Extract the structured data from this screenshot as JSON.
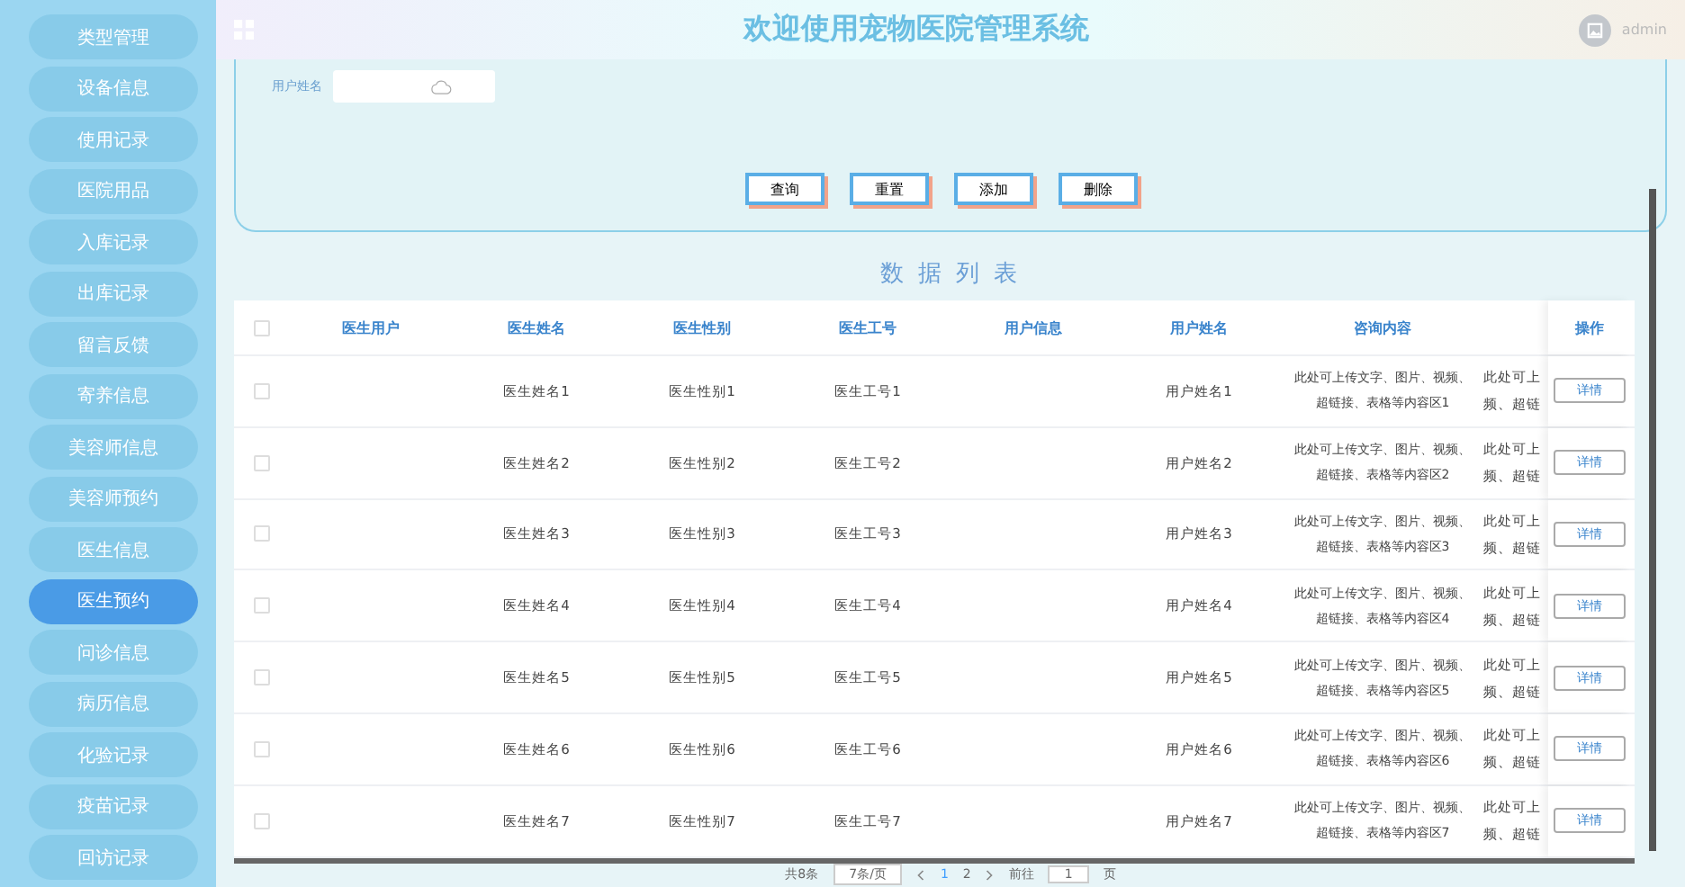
{
  "sidebar": {
    "items": [
      {
        "label": "类型管理",
        "selected": false
      },
      {
        "label": "设备信息",
        "selected": false
      },
      {
        "label": "使用记录",
        "selected": false
      },
      {
        "label": "医院用品",
        "selected": false
      },
      {
        "label": "入库记录",
        "selected": false
      },
      {
        "label": "出库记录",
        "selected": false
      },
      {
        "label": "留言反馈",
        "selected": false
      },
      {
        "label": "寄养信息",
        "selected": false
      },
      {
        "label": "美容师信息",
        "selected": false
      },
      {
        "label": "美容师预约",
        "selected": false
      },
      {
        "label": "医生信息",
        "selected": false
      },
      {
        "label": "医生预约",
        "selected": true
      },
      {
        "label": "问诊信息",
        "selected": false
      },
      {
        "label": "病历信息",
        "selected": false
      },
      {
        "label": "化验记录",
        "selected": false
      },
      {
        "label": "疫苗记录",
        "selected": false
      },
      {
        "label": "回访记录",
        "selected": false
      }
    ]
  },
  "header": {
    "title": "欢迎使用宠物医院管理系统",
    "user": "admin"
  },
  "search": {
    "label": "用户姓名",
    "buttons": [
      "查询",
      "重置",
      "添加",
      "删除"
    ]
  },
  "section_title": "数 据 列 表",
  "table": {
    "select_all_checked": false,
    "columns": [
      "医生用户",
      "医生姓名",
      "医生性别",
      "医生工号",
      "用户信息",
      "用户姓名",
      "咨询内容",
      "操作"
    ],
    "rows": [
      {
        "checked": false,
        "cells": [
          "",
          "医生姓名1",
          "医生性别1",
          "医生工号1",
          "",
          "用户姓名1",
          "此处可上传文字、图片、视频、超链接、表格等内容区1",
          "此处可上频、超链"
        ],
        "action": "详情"
      },
      {
        "checked": false,
        "cells": [
          "",
          "医生姓名2",
          "医生性别2",
          "医生工号2",
          "",
          "用户姓名2",
          "此处可上传文字、图片、视频、超链接、表格等内容区2",
          "此处可上频、超链"
        ],
        "action": "详情"
      },
      {
        "checked": false,
        "cells": [
          "",
          "医生姓名3",
          "医生性别3",
          "医生工号3",
          "",
          "用户姓名3",
          "此处可上传文字、图片、视频、超链接、表格等内容区3",
          "此处可上频、超链"
        ],
        "action": "详情"
      },
      {
        "checked": false,
        "cells": [
          "",
          "医生姓名4",
          "医生性别4",
          "医生工号4",
          "",
          "用户姓名4",
          "此处可上传文字、图片、视频、超链接、表格等内容区4",
          "此处可上频、超链"
        ],
        "action": "详情"
      },
      {
        "checked": false,
        "cells": [
          "",
          "医生姓名5",
          "医生性别5",
          "医生工号5",
          "",
          "用户姓名5",
          "此处可上传文字、图片、视频、超链接、表格等内容区5",
          "此处可上频、超链"
        ],
        "action": "详情"
      },
      {
        "checked": false,
        "cells": [
          "",
          "医生姓名6",
          "医生性别6",
          "医生工号6",
          "",
          "用户姓名6",
          "此处可上传文字、图片、视频、超链接、表格等内容区6",
          "此处可上频、超链"
        ],
        "action": "详情"
      },
      {
        "checked": false,
        "cells": [
          "",
          "医生姓名7",
          "医生性别7",
          "医生工号7",
          "",
          "用户姓名7",
          "此处可上传文字、图片、视频、超链接、表格等内容区7",
          "此处可上频、超链"
        ],
        "action": "详情"
      }
    ]
  },
  "pagination": {
    "total": "共8条",
    "page_size": "7条/页",
    "pages": [
      {
        "label": "1",
        "selected": true
      },
      {
        "label": "2",
        "selected": false
      }
    ],
    "goto_label": "前往",
    "goto_value": "1",
    "goto_suffix": "页"
  }
}
